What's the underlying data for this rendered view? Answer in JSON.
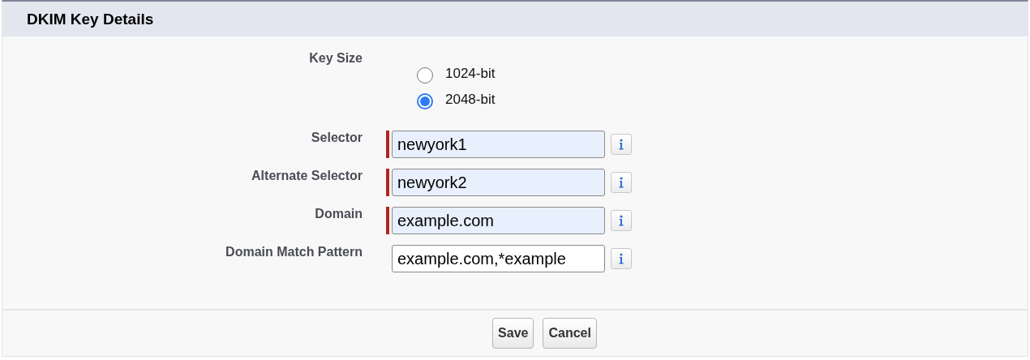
{
  "section": {
    "title": "DKIM Key Details"
  },
  "key_size": {
    "label": "Key Size",
    "options": [
      {
        "label": "1024-bit",
        "selected": false
      },
      {
        "label": "2048-bit",
        "selected": true
      }
    ]
  },
  "fields": [
    {
      "label": "Selector",
      "value": "newyork1",
      "required": true
    },
    {
      "label": "Alternate Selector",
      "value": "newyork2",
      "required": true
    },
    {
      "label": "Domain",
      "value": "example.com",
      "required": true
    },
    {
      "label": "Domain Match Pattern",
      "value": "example.com,*example",
      "required": false
    }
  ],
  "buttons": [
    {
      "label": "Save"
    },
    {
      "label": "Cancel"
    }
  ]
}
